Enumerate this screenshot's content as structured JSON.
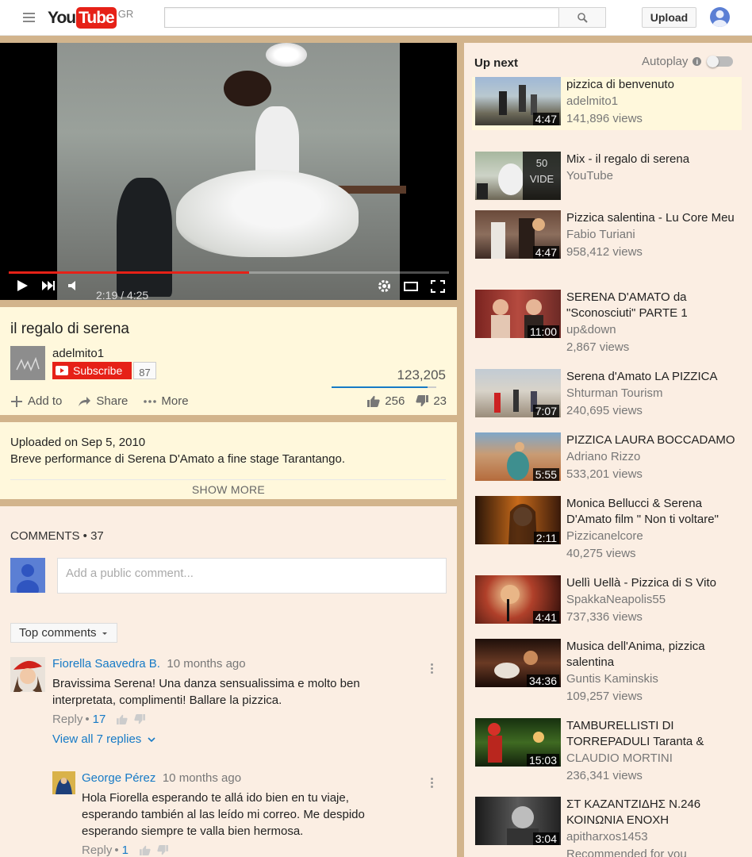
{
  "header": {
    "logo_you": "You",
    "logo_tube": "Tube",
    "country": "GR",
    "search_placeholder": "",
    "upload_label": "Upload"
  },
  "player": {
    "time": "2:19 / 4:25",
    "progress_fraction": 0.546
  },
  "video": {
    "title": "il regalo di serena",
    "owner": "adelmito1",
    "subscribe_label": "Subscribe",
    "subscriber_count": "87",
    "views": "123,205",
    "like_fraction": 0.92,
    "actions": {
      "add_to": "Add to",
      "share": "Share",
      "more": "More"
    },
    "likes": "256",
    "dislikes": "23"
  },
  "description": {
    "upload_date": "Uploaded on Sep 5, 2010",
    "text": "Breve performance di Serena D'Amato a fine stage Tarantango.",
    "show_more": "SHOW MORE"
  },
  "comments": {
    "header": "COMMENTS • 37",
    "placeholder": "Add a public comment...",
    "sort_label": "Top comments",
    "items": [
      {
        "author": "Fiorella Saavedra B.",
        "time": "10 months ago",
        "text_line1": "Bravissima Serena! Una danza sensualissima e molto ben",
        "text_line2": "interpretata, complimenti! Ballare la pizzica.",
        "reply": "Reply",
        "likes": "17",
        "view_replies": "View all 7 replies"
      },
      {
        "author": "George Pérez",
        "time": "10 months ago",
        "text_line1": "Hola Fiorella esperando te allá ido bien en tu viaje,",
        "text_line2": "esperando también al las leído mi correo. Me despido",
        "text_line3": "esperando siempre te valla bien hermosa.",
        "reply": "Reply",
        "likes": "1"
      }
    ]
  },
  "sidebar": {
    "upnext_label": "Up next",
    "autoplay_label": "Autoplay",
    "videos": [
      {
        "title": "pizzica di benvenuto",
        "channel": "adelmito1",
        "views": "141,896 views",
        "duration": "4:47"
      },
      {
        "title": "Mix - il regalo di serena",
        "channel": "YouTube",
        "views": "",
        "duration": "",
        "mix_line1": "50",
        "mix_line2": "VIDE"
      },
      {
        "title": "Pizzica salentina - Lu Core Meu",
        "channel": "Fabio Turiani",
        "views": "958,412 views",
        "duration": "4:47"
      },
      {
        "title": "SERENA D'AMATO da \"Sconosciuti\" PARTE 1",
        "channel": "up&down",
        "views": "2,867 views",
        "duration": "11:00"
      },
      {
        "title": "Serena d'Amato LA PIZZICA",
        "channel": "Shturman Tourism",
        "views": "240,695 views",
        "duration": "7:07"
      },
      {
        "title": "PIZZICA LAURA BOCCADAMO",
        "channel": "Adriano Rizzo",
        "views": "533,201 views",
        "duration": "5:55"
      },
      {
        "title": "Monica Bellucci & Serena D'Amato film \" Non ti voltare\"",
        "channel": "Pizzicanelcore",
        "views": "40,275 views",
        "duration": "2:11"
      },
      {
        "title": "Uellì Uellà - Pizzica di S Vito",
        "channel": "SpakkaNeapolis55",
        "views": "737,336 views",
        "duration": "4:41"
      },
      {
        "title": "Musica dell'Anima, pizzica salentina",
        "channel": "Guntis Kaminskis",
        "views": "109,257 views",
        "duration": "34:36"
      },
      {
        "title": "TAMBURELLISTI DI TORREPADULI Taranta &",
        "channel": "CLAUDIO MORTINI",
        "views": "236,341 views",
        "duration": "15:03"
      },
      {
        "title": "ΣΤ ΚΑΖΑΝΤΖΙΔΗΣ Ν.246 ΚΟΙΝΩΝΙΑ ΕΝΟΧΗ",
        "channel": "apitharxos1453",
        "views": "Recommended for you",
        "duration": "3:04"
      }
    ]
  },
  "colors": {
    "page_bg": "#d2b48c",
    "panel_bg": "#fff8dc",
    "comments_bg": "#fbeee3",
    "accent_red": "#e62117",
    "link_blue": "#167ac6"
  }
}
